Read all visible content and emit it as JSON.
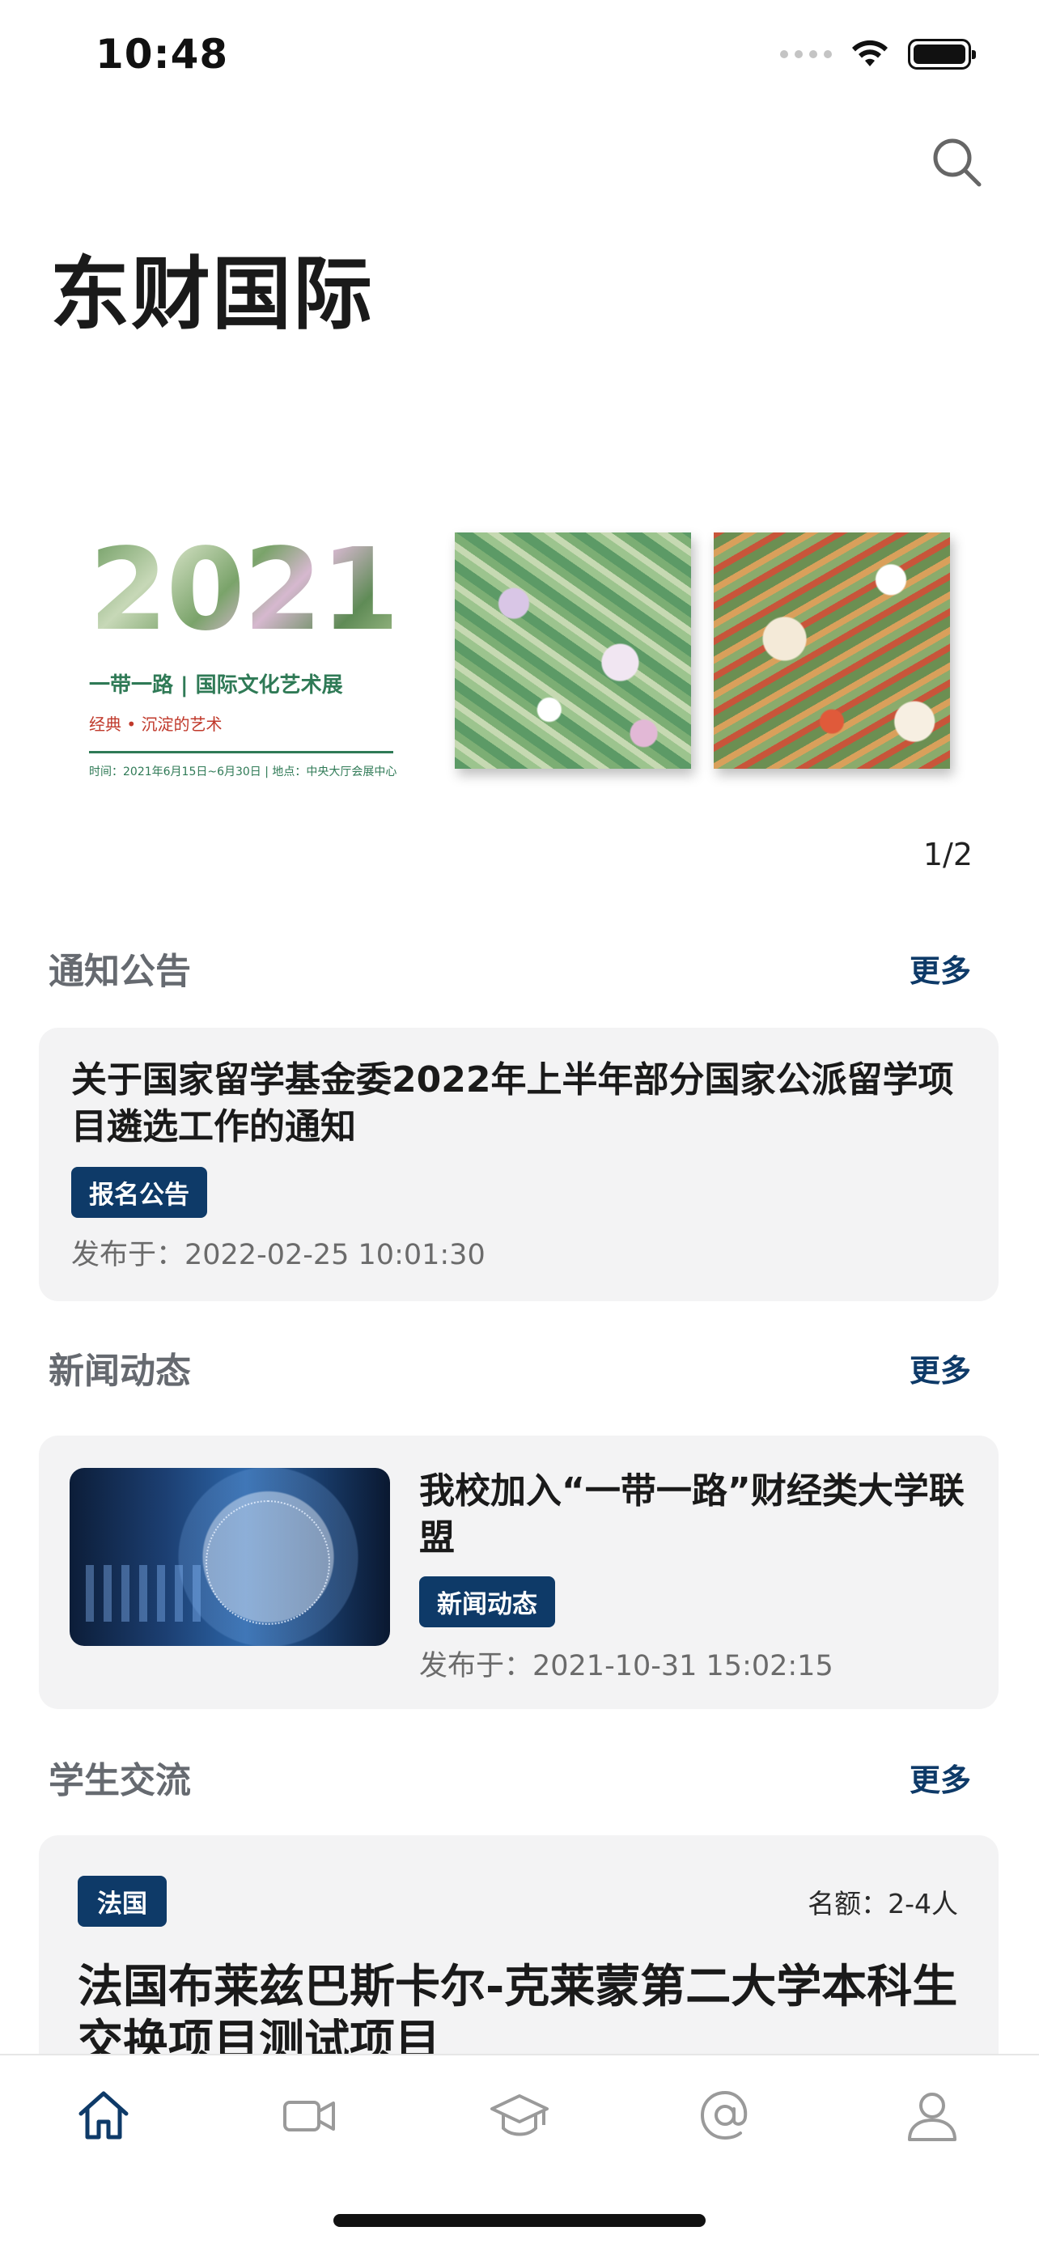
{
  "status_bar": {
    "time": "10:48"
  },
  "header": {
    "title": "东财国际",
    "search_icon": "search-icon"
  },
  "banner": {
    "poster": {
      "year": "2021",
      "line1": "一带一路 | 国际文化艺术展",
      "line2": "经典 • 沉淀的艺术",
      "line3": "时间：2021年6月15日~6月30日 | 地点：中央大厅会展中心"
    },
    "indicator": "1/2"
  },
  "sections": {
    "notices": {
      "title": "通知公告",
      "more": "更多",
      "item": {
        "title": "关于国家留学基金委2022年上半年部分国家公派留学项目遴选工作的通知",
        "tag": "报名公告",
        "published": "发布于：2022-02-25 10:01:30"
      }
    },
    "news": {
      "title": "新闻动态",
      "more": "更多",
      "item": {
        "title": "我校加入“一带一路”财经类大学联盟",
        "tag": "新闻动态",
        "published": "发布于：2021-10-31 15:02:15"
      }
    },
    "exchange": {
      "title": "学生交流",
      "more": "更多",
      "item": {
        "country": "法国",
        "quota": "名额：2-4人",
        "title": "法国布莱兹巴斯卡尔-克莱蒙第二大学本科生交换项目测试项目"
      }
    }
  },
  "tab_bar": {
    "items": [
      {
        "icon": "home-icon",
        "active": true
      },
      {
        "icon": "video-icon",
        "active": false
      },
      {
        "icon": "graduation-cap-icon",
        "active": false
      },
      {
        "icon": "at-icon",
        "active": false
      },
      {
        "icon": "user-icon",
        "active": false
      }
    ]
  },
  "colors": {
    "accent": "#0e3a68",
    "card_bg": "#f3f3f4",
    "inactive_icon": "#9a9a9a"
  }
}
